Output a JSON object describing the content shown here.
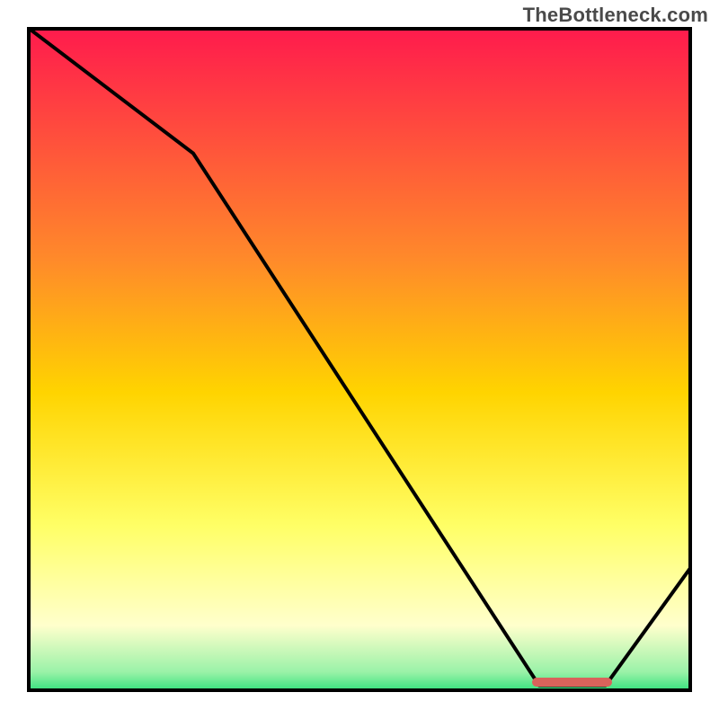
{
  "watermark": "TheBottleneck.com",
  "colors": {
    "top": "#ff1a4d",
    "mid_upper": "#ff8a2a",
    "mid": "#ffd400",
    "mid_lower": "#ffff66",
    "pale": "#ffffcc",
    "green": "#2fe07a",
    "line": "#000000",
    "marker": "#d9635b",
    "frame": "#000000"
  },
  "chart_data": {
    "type": "line",
    "title": "",
    "xlabel": "",
    "ylabel": "",
    "xlim": [
      0,
      100
    ],
    "ylim": [
      0,
      100
    ],
    "x": [
      0,
      25,
      77,
      87,
      100
    ],
    "values": [
      100,
      81,
      1,
      1,
      19
    ],
    "marker_range_x": [
      76,
      88
    ],
    "marker_y": 1.5,
    "background_gradient_stops": [
      {
        "pos": 0,
        "hex": "#ff1a4d"
      },
      {
        "pos": 35,
        "hex": "#ff8a2a"
      },
      {
        "pos": 55,
        "hex": "#ffd400"
      },
      {
        "pos": 75,
        "hex": "#ffff66"
      },
      {
        "pos": 90,
        "hex": "#ffffcc"
      },
      {
        "pos": 97,
        "hex": "#9af2a8"
      },
      {
        "pos": 100,
        "hex": "#2fe07a"
      }
    ]
  }
}
